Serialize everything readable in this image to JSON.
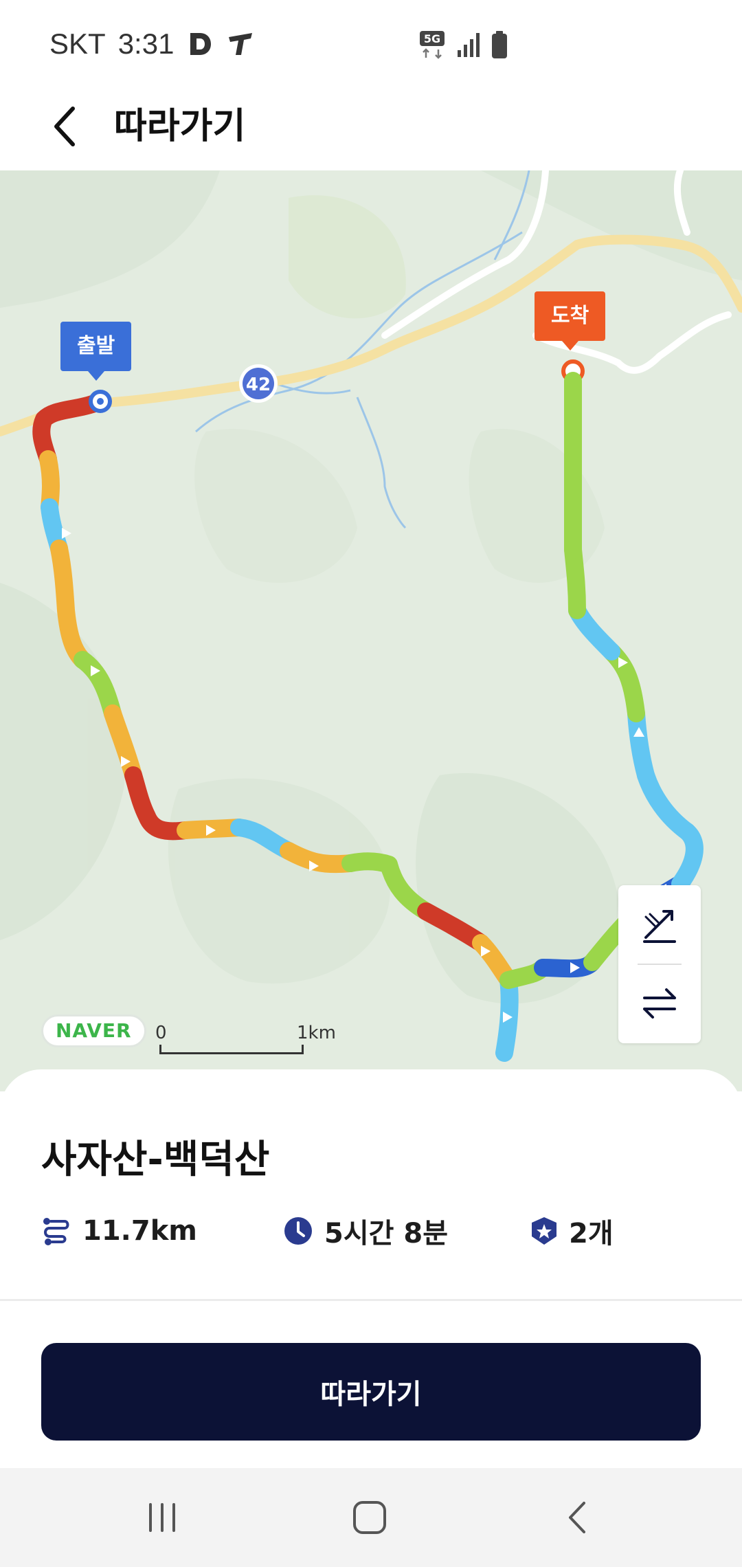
{
  "status_bar": {
    "carrier": "SKT",
    "time": "3:31",
    "network": "5G",
    "icons": [
      "d-app-icon",
      "t-app-icon",
      "5g-icon",
      "signal-icon",
      "battery-icon"
    ]
  },
  "header": {
    "back_icon": "chevron-left-icon",
    "title": "따라가기"
  },
  "map": {
    "start_label": "출발",
    "end_label": "도착",
    "road_number": "42",
    "provider": "NAVER",
    "scale": {
      "min_label": "0",
      "max_label": "1km"
    },
    "controls": [
      "elevation-slope-icon",
      "swap-direction-icon"
    ],
    "segment_colors": {
      "easy": "#9bd64a",
      "flat": "#62c6f2",
      "moderate": "#f2b33a",
      "steep": "#cf3a28",
      "descent": "#2b63d1"
    },
    "start_color": "#3a6fd8",
    "end_color": "#ee5a24"
  },
  "course": {
    "name": "사자산-백덕산",
    "distance": "11.7km",
    "duration": "5시간 8분",
    "stamps": "2개",
    "distance_icon": "route-icon",
    "duration_icon": "clock-icon",
    "stamps_icon": "badge-star-icon"
  },
  "cta": {
    "follow_label": "따라가기",
    "button_color": "#0c1236"
  },
  "nav_bar": {
    "recents_icon": "recents-icon",
    "home_icon": "home-icon",
    "back_icon": "back-icon"
  }
}
